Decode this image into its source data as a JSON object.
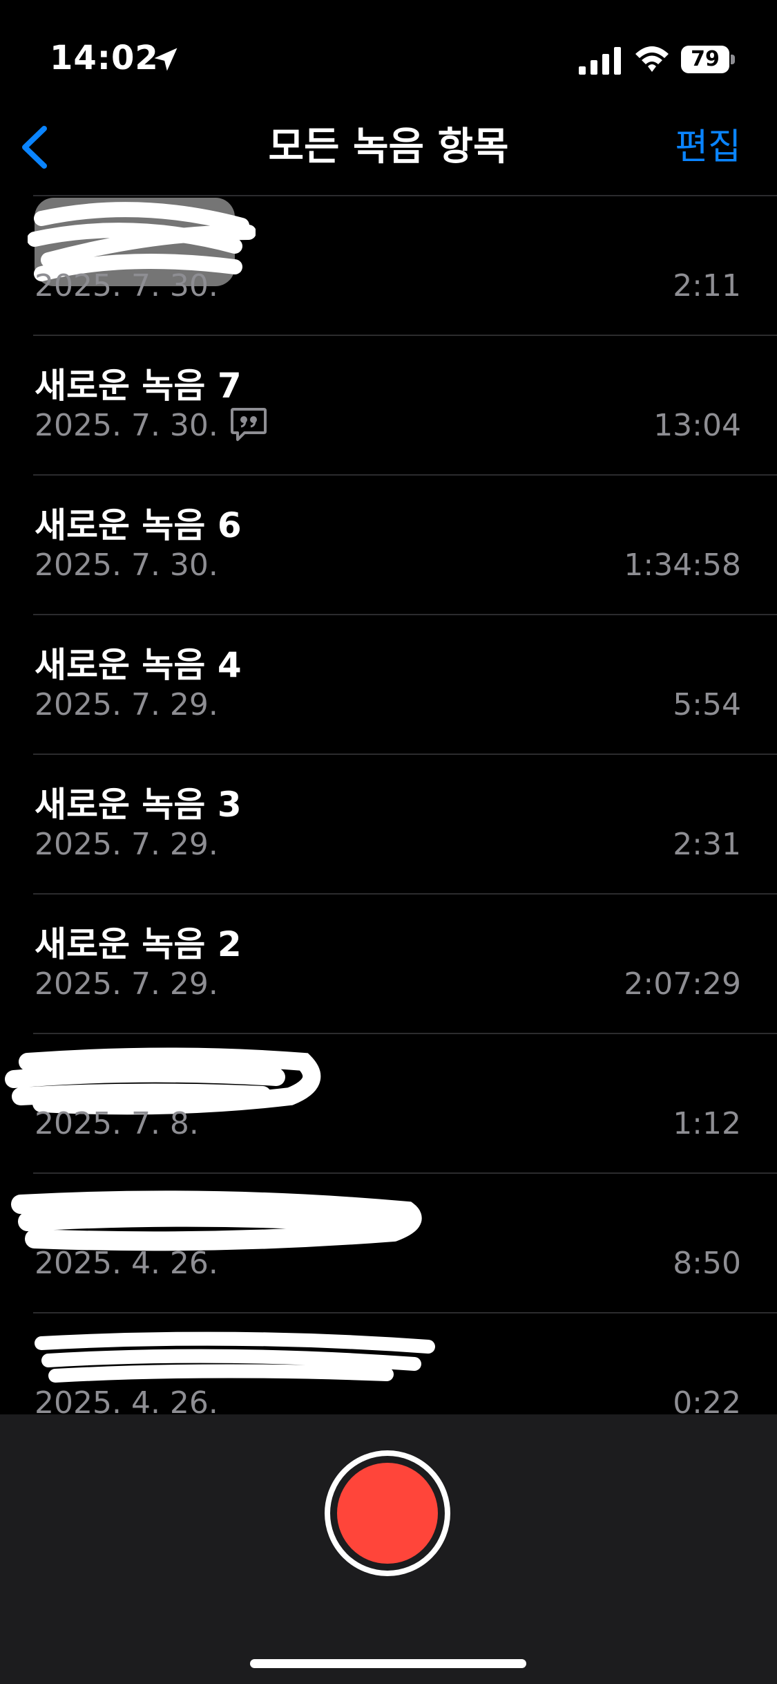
{
  "status_bar": {
    "time": "14:02",
    "battery": "79",
    "icons": [
      "location-arrow-icon",
      "cellular-signal-icon",
      "wifi-icon",
      "battery-icon"
    ]
  },
  "nav": {
    "back_icon": "chevron-left-icon",
    "title": "모든 녹음 항목",
    "edit_label": "편집"
  },
  "colors": {
    "accent": "#0a84ff",
    "record": "#ff453a",
    "secondary_text": "#8e8e93",
    "panel": "#1c1c1e"
  },
  "recordings": [
    {
      "title": "",
      "redacted": true,
      "date": "2025. 7. 30.",
      "duration": "2:11"
    },
    {
      "title": "새로운 녹음 7",
      "date": "2025. 7. 30.",
      "duration": "13:04",
      "transcript_icon": "quote-bubble-icon"
    },
    {
      "title": "새로운 녹음 6",
      "date": "2025. 7. 30.",
      "duration": "1:34:58"
    },
    {
      "title": "새로운 녹음 4",
      "date": "2025. 7. 29.",
      "duration": "5:54"
    },
    {
      "title": "새로운 녹음 3",
      "date": "2025. 7. 29.",
      "duration": "2:31"
    },
    {
      "title": "새로운 녹음 2",
      "date": "2025. 7. 29.",
      "duration": "2:07:29"
    },
    {
      "title": "",
      "redacted": true,
      "date": "2025. 7. 8.",
      "duration": "1:12"
    },
    {
      "title": "",
      "redacted": true,
      "date": "2025. 4. 26.",
      "duration": "8:50"
    },
    {
      "title": "",
      "redacted": true,
      "date": "2025. 4. 26.",
      "duration": "0:22"
    }
  ],
  "record_button": {
    "icon": "record-circle-icon"
  }
}
